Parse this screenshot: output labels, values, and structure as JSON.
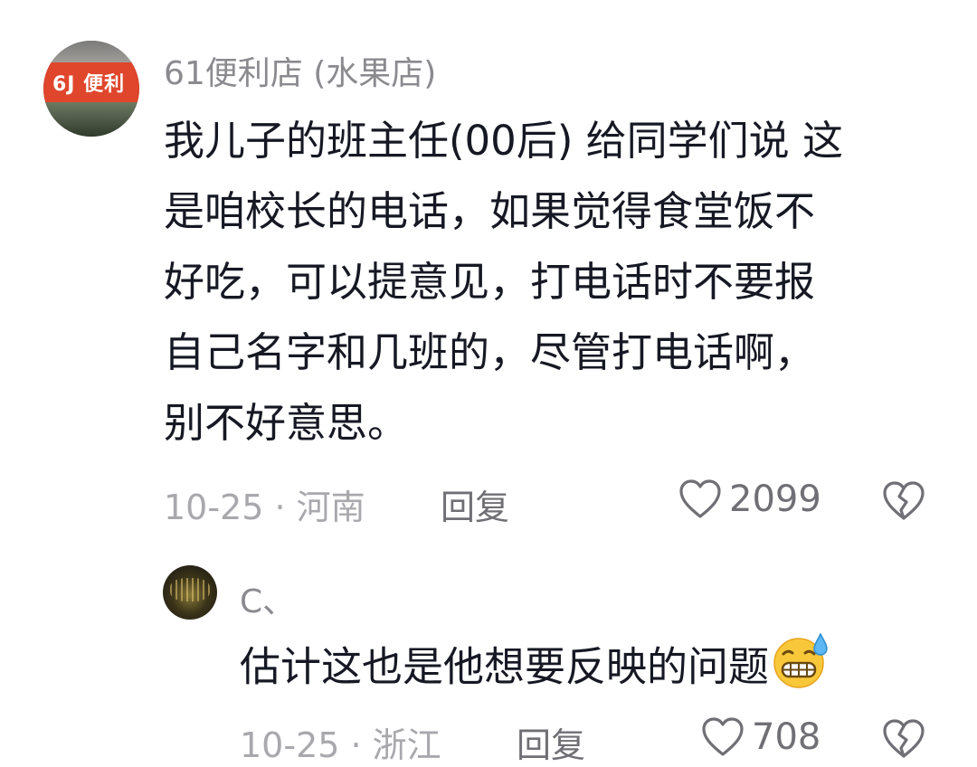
{
  "comments": [
    {
      "username": "61便利店 (水果店)",
      "avatar_sign": "6J 便利",
      "text": "我儿子的班主任(00后) 给同学们说 这\n是咱校长的电话，如果觉得食堂饭不\n好吃，可以提意见，打电话时不要报\n自己名字和几班的，尽管打电话啊，\n别不好意思。",
      "meta": "10-25 · 河南",
      "reply_label": "回复",
      "likes": "2099",
      "like_icon": "heart-outline-icon",
      "dislike_icon": "broken-heart-icon"
    },
    {
      "username": "C、",
      "text": "估计这也是他想要反映的问题",
      "emoji": "grimacing-sweat-emoji",
      "meta": "10-25 · 浙江",
      "reply_label": "回复",
      "likes": "708",
      "like_icon": "heart-outline-icon",
      "dislike_icon": "broken-heart-icon"
    }
  ],
  "colors": {
    "text_primary": "#161823",
    "text_secondary": "#8a8a8f",
    "meta": "#a8a8ad",
    "action": "#6f6f75"
  }
}
